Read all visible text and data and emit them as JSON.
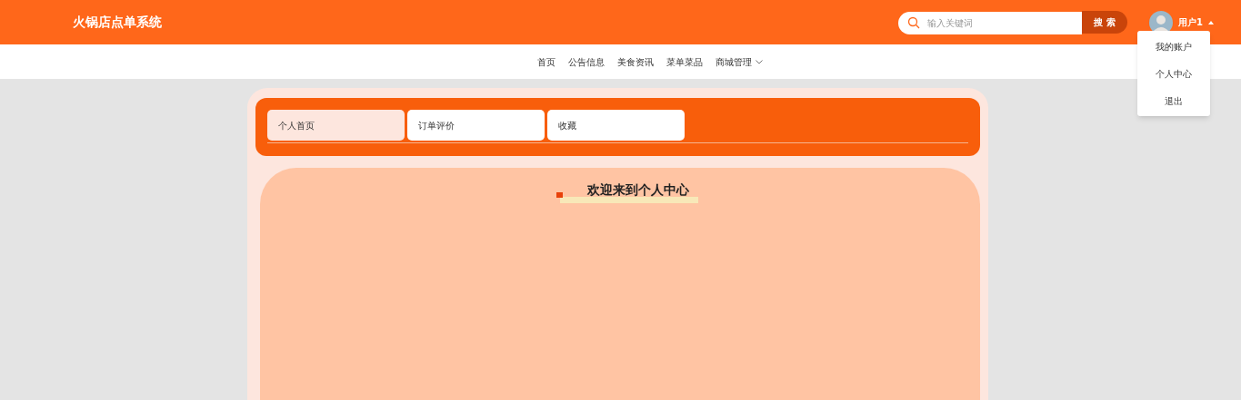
{
  "header": {
    "title": "火锅店点单系统",
    "search": {
      "placeholder": "输入关键词",
      "button": "搜 索"
    },
    "user": {
      "name": "用户1"
    }
  },
  "user_menu": [
    "我的账户",
    "个人中心",
    "退出"
  ],
  "nav": [
    {
      "label": "首页",
      "kind": "link"
    },
    {
      "label": "公告信息",
      "kind": "link"
    },
    {
      "label": "美食资讯",
      "kind": "link"
    },
    {
      "label": "菜单菜品",
      "kind": "link"
    },
    {
      "label": "商城管理",
      "kind": "dropdown"
    }
  ],
  "tabs": [
    {
      "label": "个人首页",
      "selected": true
    },
    {
      "label": "订单评价",
      "selected": false
    },
    {
      "label": "收藏",
      "selected": false
    }
  ],
  "content": {
    "heading": "欢迎来到个人中心"
  }
}
